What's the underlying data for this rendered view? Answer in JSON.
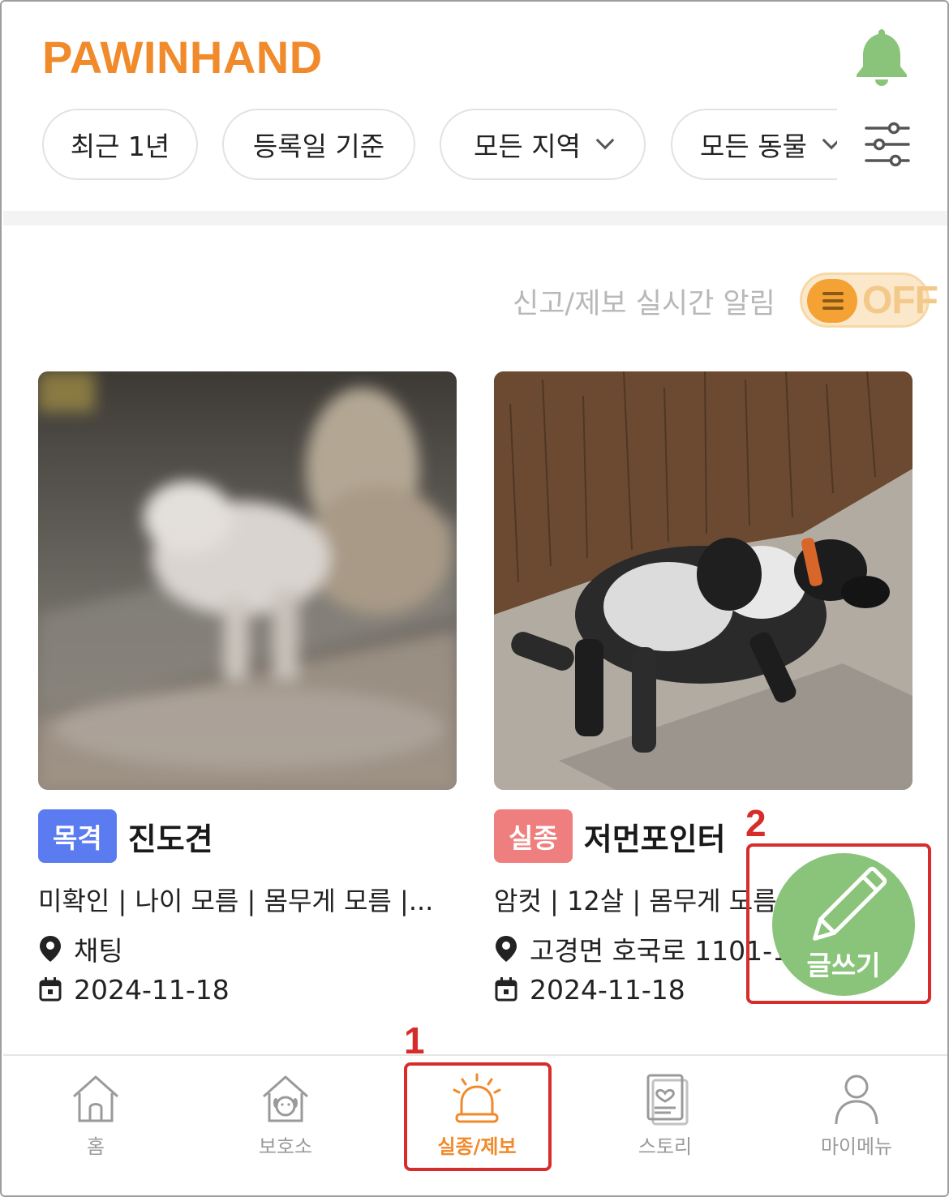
{
  "header": {
    "logo": "PAWINHAND",
    "bell_icon": "bell-icon",
    "accent": "#f08a2a",
    "bell_color": "#89c47a"
  },
  "filters": [
    {
      "label": "최근 1년",
      "dropdown": false
    },
    {
      "label": "등록일 기준",
      "dropdown": false
    },
    {
      "label": "모든 지역",
      "dropdown": true
    },
    {
      "label": "모든 동물",
      "dropdown": true
    }
  ],
  "filter_icon": "sliders-icon",
  "realtime_alert": {
    "label": "신고/제보 실시간 알림",
    "toggle_state": "OFF"
  },
  "posts": [
    {
      "tag": "목격",
      "tag_color": "#5b7cf0",
      "title": "진도견",
      "info": "미확인 | 나이 모름 | 몸무게 모름 |...",
      "location": "채팅",
      "date": "2024-11-18"
    },
    {
      "tag": "실종",
      "tag_color": "#ef7f7f",
      "title": "저먼포인터",
      "info": "암컷 | 12살 | 몸무게 모름",
      "location": "고경면 호국로 1101-1",
      "date": "2024-11-18"
    }
  ],
  "fab": {
    "label": "글쓰기",
    "icon": "pencil-icon"
  },
  "annotations": [
    {
      "number": "1"
    },
    {
      "number": "2"
    }
  ],
  "bottom_nav": [
    {
      "label": "홈",
      "icon": "home-icon",
      "active": false
    },
    {
      "label": "보호소",
      "icon": "shelter-icon",
      "active": false
    },
    {
      "label": "실종/제보",
      "icon": "siren-icon",
      "active": true
    },
    {
      "label": "스토리",
      "icon": "story-icon",
      "active": false
    },
    {
      "label": "마이메뉴",
      "icon": "person-icon",
      "active": false
    }
  ]
}
